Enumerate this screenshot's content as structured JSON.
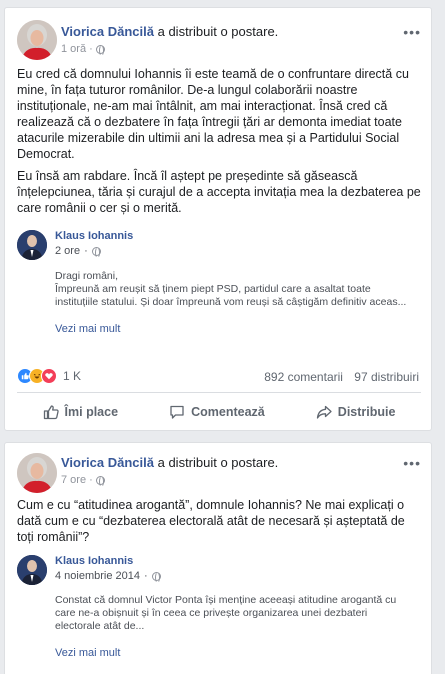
{
  "posts": [
    {
      "author": "Viorica Dăncilă",
      "action_text": "a distribuit o postare.",
      "time": "1 oră",
      "more_label": "•••",
      "paragraphs": [
        "Eu cred că domnului Iohannis îi este teamă de o confruntare directă cu mine, în fața tuturor românilor. De-a lungul colaborării noastre instituționale, ne-am mai întâlnit, am mai interacționat. Însă cred că realizează că o dezbatere în fața întregii țări ar demonta imediat toate atacurile mizerabile din ultimii ani la adresa mea și a Partidului Social Democrat.",
        "Eu însă am rabdare. Încă îl aștept pe președinte să găsească înțelepciunea, tăria și curajul de a accepta invitația mea la dezbaterea pe care românii o cer și o merită."
      ],
      "shared": {
        "author": "Klaus Iohannis",
        "time": "2 ore",
        "body_lines": [
          "Dragi români,",
          "Împreună am reușit să ținem piept PSD, partidul care a asaltat toate instituțiile statului. Și doar împreună vom reuși să câștigăm definitiv aceas..."
        ],
        "see_more": "Vezi mai mult"
      },
      "reactions_count": "1 K",
      "comments": "892 comentarii",
      "shares": "97 distribuiri",
      "actions": {
        "like": "Îmi place",
        "comment": "Comentează",
        "share": "Distribuie"
      }
    },
    {
      "author": "Viorica Dăncilă",
      "action_text": "a distribuit o postare.",
      "time": "7 ore",
      "more_label": "•••",
      "paragraphs": [
        "Cum e cu “atitudinea arogantă”, domnule Iohannis? Ne mai explicați o dată cum e cu “dezbaterea electorală atât de necesară și așteptată de toți românii”?"
      ],
      "shared": {
        "author": "Klaus Iohannis",
        "time": "4 noiembrie 2014",
        "body_lines": [
          "Constat că domnul Victor Ponta își menține aceeași atitudine arogantă cu care ne-a obișnuit și în ceea ce privește organizarea unei dezbateri electorale atât de..."
        ],
        "see_more": "Vezi mai mult"
      }
    }
  ],
  "colors": {
    "link": "#385898",
    "secondary": "#606770",
    "background": "#e9ebee",
    "like_blue": "#2d88ff"
  },
  "icons": [
    "globe-icon",
    "more-options-icon",
    "like-reaction-icon",
    "haha-reaction-icon",
    "love-reaction-icon",
    "thumbs-up-icon",
    "comment-icon",
    "share-icon"
  ]
}
